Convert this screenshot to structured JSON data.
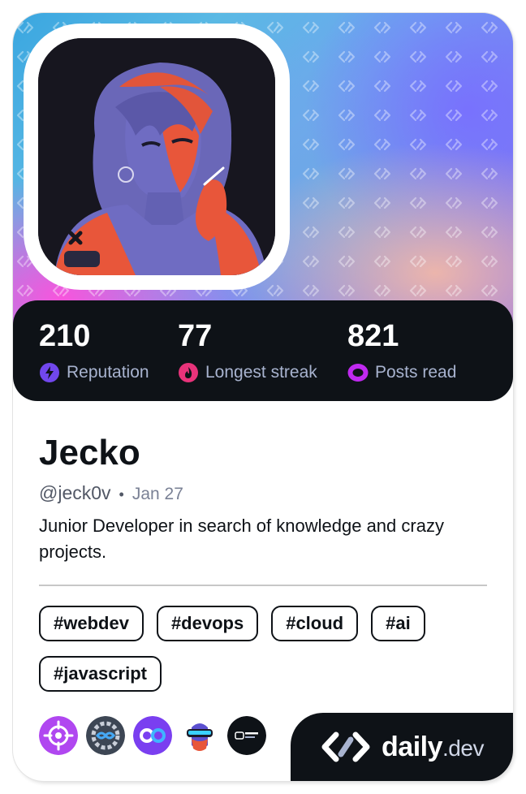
{
  "profile": {
    "name": "Jecko",
    "handle": "@jeck0v",
    "joined": "Jan 27",
    "bio": "Junior Developer in search of knowledge and crazy projects."
  },
  "stats": [
    {
      "value": "210",
      "label": "Reputation",
      "icon": "lightning-icon",
      "color": "#7147ed"
    },
    {
      "value": "77",
      "label": "Longest streak",
      "icon": "flame-icon",
      "color": "#e04337"
    },
    {
      "value": "821",
      "label": "Posts read",
      "icon": "eye-icon",
      "color": "#c029f0"
    }
  ],
  "tags": [
    "#webdev",
    "#devops",
    "#cloud",
    "#ai",
    "#javascript"
  ],
  "badges": [
    "crosshair-badge-icon",
    "infinity-gear-badge-icon",
    "infinity-badge-icon",
    "vr-headset-badge-icon",
    "backend-developer-badge-icon"
  ],
  "brand": {
    "main": "daily",
    "suffix": ".dev"
  },
  "colors": {
    "dark": "#0e1217",
    "muted": "#a8b3cf",
    "accent_purple": "#7147ed"
  }
}
